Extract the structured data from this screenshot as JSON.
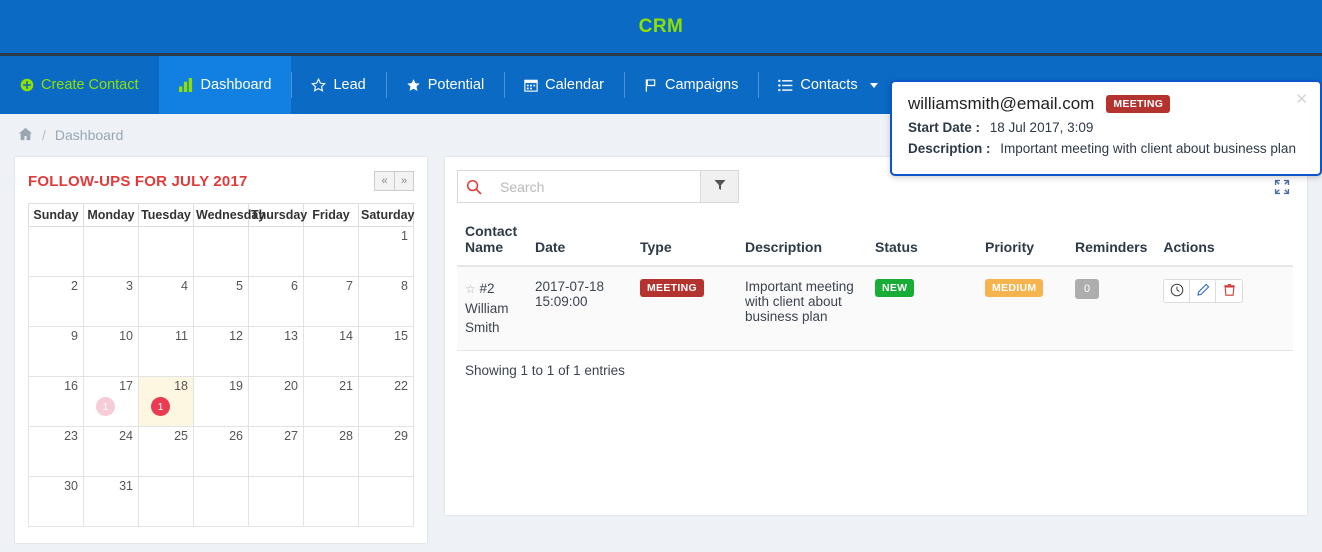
{
  "app": {
    "brand": "CRM"
  },
  "nav": {
    "items": [
      {
        "label": "Create Contact",
        "icon": "plus-circle-icon",
        "style": "green",
        "active": false
      },
      {
        "label": "Dashboard",
        "icon": "bar-chart-icon",
        "style": "normal",
        "active": true
      },
      {
        "label": "Lead",
        "icon": "star-outline-icon",
        "style": "normal",
        "active": false
      },
      {
        "label": "Potential",
        "icon": "star-filled-icon",
        "style": "normal",
        "active": false
      },
      {
        "label": "Calendar",
        "icon": "calendar-icon",
        "style": "normal",
        "active": false
      },
      {
        "label": "Campaigns",
        "icon": "flag-icon",
        "style": "normal",
        "active": false
      },
      {
        "label": "Contacts",
        "icon": "list-icon",
        "style": "normal",
        "active": false,
        "caret": true
      }
    ]
  },
  "breadcrumb": {
    "home_icon": "home-icon",
    "separator": "/",
    "current": "Dashboard",
    "right_label": "Dashboard"
  },
  "calendar": {
    "title": "FOLLOW-UPS FOR JULY 2017",
    "prev_label": "«",
    "next_label": "»",
    "weekdays": [
      "Sunday",
      "Monday",
      "Tuesday",
      "Wednesday",
      "Thursday",
      "Friday",
      "Saturday"
    ],
    "weeks": [
      [
        {
          "d": ""
        },
        {
          "d": ""
        },
        {
          "d": ""
        },
        {
          "d": ""
        },
        {
          "d": ""
        },
        {
          "d": ""
        },
        {
          "d": "1"
        }
      ],
      [
        {
          "d": "2"
        },
        {
          "d": "3"
        },
        {
          "d": "4"
        },
        {
          "d": "5"
        },
        {
          "d": "6"
        },
        {
          "d": "7"
        },
        {
          "d": "8"
        }
      ],
      [
        {
          "d": "9"
        },
        {
          "d": "10"
        },
        {
          "d": "11"
        },
        {
          "d": "12"
        },
        {
          "d": "13"
        },
        {
          "d": "14"
        },
        {
          "d": "15"
        }
      ],
      [
        {
          "d": "16"
        },
        {
          "d": "17",
          "badge": "1",
          "badge_style": "faded"
        },
        {
          "d": "18",
          "badge": "1",
          "badge_style": "solid",
          "today": true
        },
        {
          "d": "19"
        },
        {
          "d": "20"
        },
        {
          "d": "21"
        },
        {
          "d": "22"
        }
      ],
      [
        {
          "d": "23"
        },
        {
          "d": "24"
        },
        {
          "d": "25"
        },
        {
          "d": "26"
        },
        {
          "d": "27"
        },
        {
          "d": "28"
        },
        {
          "d": "29"
        }
      ],
      [
        {
          "d": "30"
        },
        {
          "d": "31"
        },
        {
          "d": ""
        },
        {
          "d": ""
        },
        {
          "d": ""
        },
        {
          "d": ""
        },
        {
          "d": ""
        }
      ]
    ]
  },
  "table": {
    "search": {
      "placeholder": "Search",
      "value": "",
      "icon": "search-icon"
    },
    "filter_icon": "funnel-icon",
    "expand_icon": "expand-icon",
    "columns": [
      "Contact Name",
      "Date",
      "Type",
      "Description",
      "Status",
      "Priority",
      "Reminders",
      "Actions"
    ],
    "rows": [
      {
        "star_icon": "star-outline-icon",
        "contact_id": "#2",
        "contact_name": "William Smith",
        "date": "2017-07-18 15:09:00",
        "type": "MEETING",
        "description": "Important meeting with client about business plan",
        "status": "NEW",
        "priority": "MEDIUM",
        "reminders": "0",
        "actions": [
          "clock-icon",
          "pencil-icon",
          "trash-icon"
        ]
      }
    ],
    "footer": "Showing 1 to 1 of 1 entries"
  },
  "popup": {
    "email": "williamsmith@email.com",
    "type_badge": "MEETING",
    "close_icon": "close-icon",
    "start_date_label": "Start Date :",
    "start_date_value": "18 Jul 2017, 3:09",
    "description_label": "Description :",
    "description_value": "Important meeting with client about business plan"
  },
  "colors": {
    "nav_blue": "#0a6ac4",
    "nav_active_blue": "#1180e0",
    "brand_green": "#8ee000",
    "title_red": "#e03a3a",
    "meeting_red": "#b5332f",
    "status_green": "#17ad37",
    "priority_orange": "#f5b44d",
    "popup_border": "#0d55c8"
  }
}
